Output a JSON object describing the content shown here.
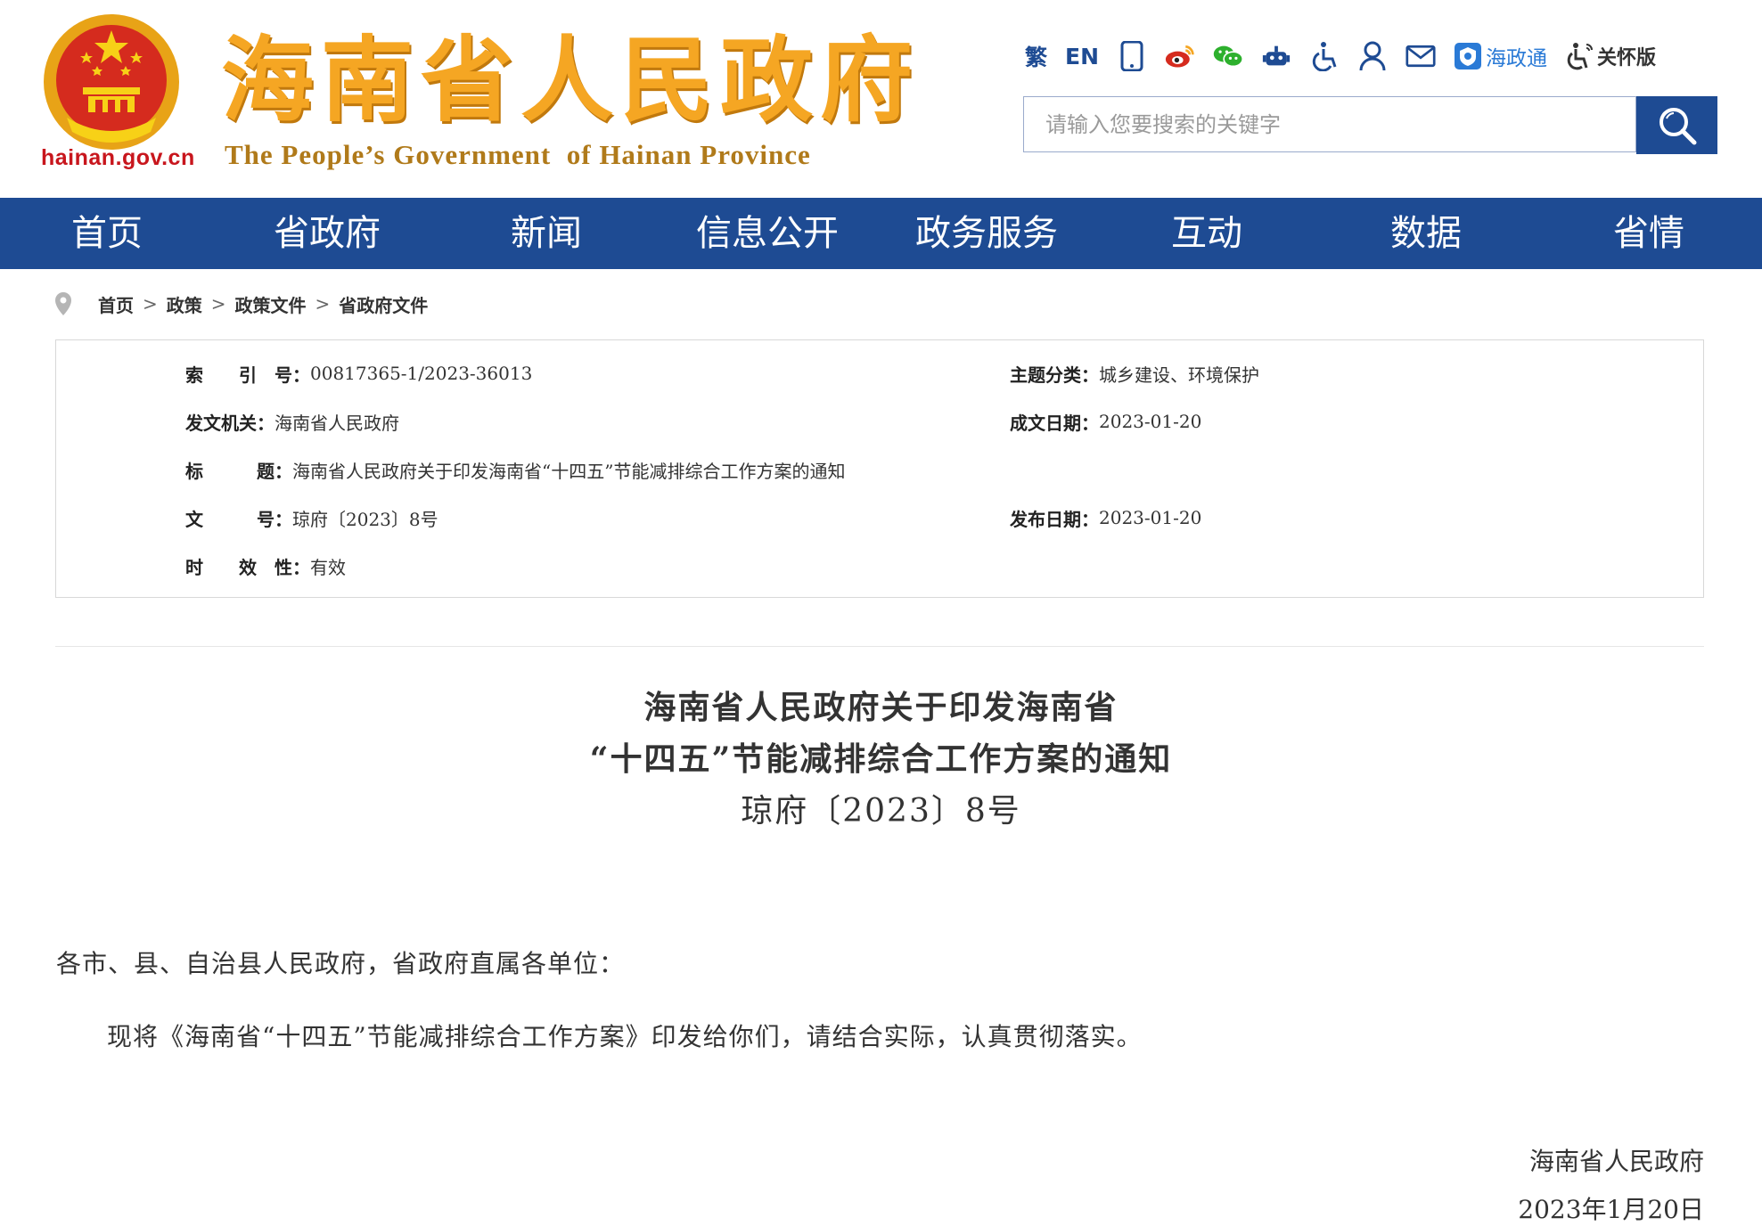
{
  "header": {
    "domain": "hainan.gov.cn",
    "title": "海南省人民政府",
    "subtitle": "The People’s Government  of Hainan Province",
    "toolbar": {
      "traditional": "繁",
      "english": "EN",
      "hzt_label": "海政通",
      "care_label": "关怀版"
    },
    "search": {
      "placeholder": "请输入您要搜索的关键字"
    }
  },
  "nav": {
    "items": [
      "首页",
      "省政府",
      "新闻",
      "信息公开",
      "政务服务",
      "互动",
      "数据",
      "省情"
    ]
  },
  "breadcrumb": [
    "首页",
    "政策",
    "政策文件",
    "省政府文件"
  ],
  "meta": {
    "index_label": "索　　引　号：",
    "index_value": "00817365-1/2023-36013",
    "topic_label": "主题分类：",
    "topic_value": "城乡建设、环境保护",
    "issuer_label": "发文机关：",
    "issuer_value": "海南省人民政府",
    "written_label": "成文日期：",
    "written_value": "2023-01-20",
    "title_label": "标　　　题：",
    "title_value": "海南省人民政府关于印发海南省“十四五”节能减排综合工作方案的通知",
    "docno_label": "文　　　号：",
    "docno_value": "琼府〔2023〕8号",
    "published_label": "发布日期：",
    "published_value": "2023-01-20",
    "validity_label": "时　　效　性：",
    "validity_value": "有效"
  },
  "article": {
    "title_line1": "海南省人民政府关于印发海南省",
    "title_line2": "“十四五”节能减排综合工作方案的通知",
    "docno": "琼府〔2023〕8号",
    "salutation": "各市、县、自治县人民政府，省政府直属各单位：",
    "paragraph1": "现将《海南省“十四五”节能减排综合工作方案》印发给你们，请结合实际，认真贯彻落实。",
    "signature": "海南省人民政府",
    "date": "2023年1月20日"
  },
  "colors": {
    "brand_blue": "#1e4b93",
    "title_gold": "#f5a623",
    "emblem_red": "#c8161d"
  }
}
